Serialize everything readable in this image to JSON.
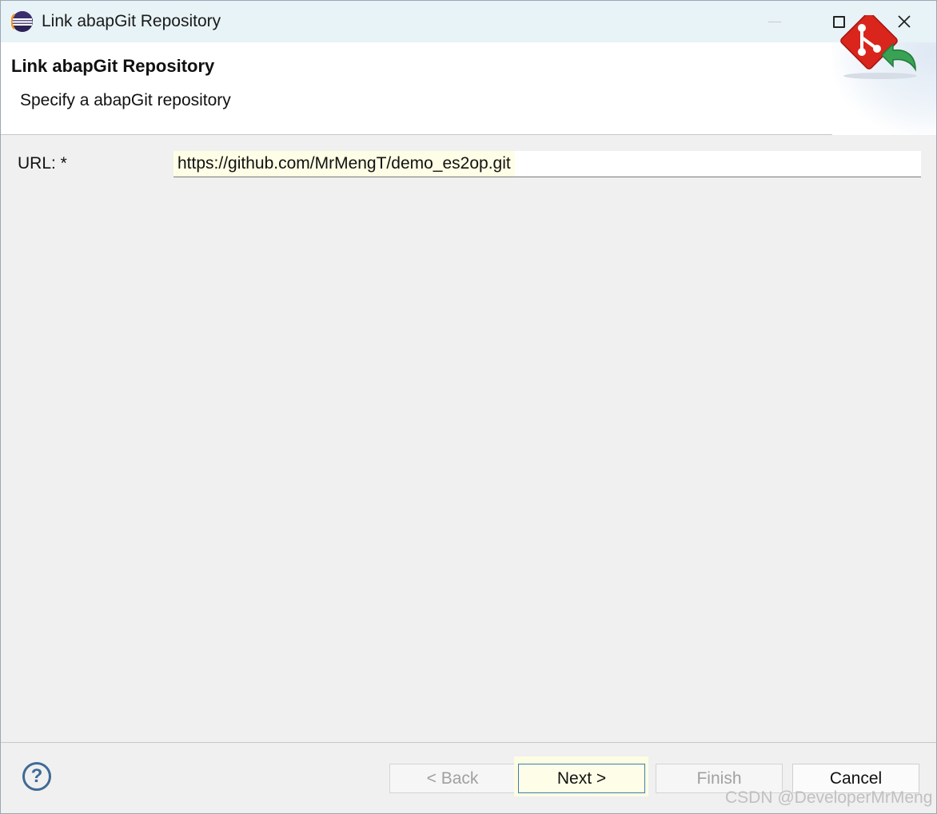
{
  "window": {
    "title": "Link abapGit Repository",
    "app_icon": "eclipse-icon"
  },
  "banner": {
    "title": "Link abapGit Repository",
    "description": "Specify a abapGit repository",
    "logo_icon": "git-link-icon"
  },
  "form": {
    "url_label": "URL: *",
    "url_value": "https://github.com/MrMengT/demo_es2op.git"
  },
  "footer": {
    "help_icon": "help-icon",
    "help_glyph": "?",
    "back_label": "< Back",
    "next_label": "Next >",
    "finish_label": "Finish",
    "cancel_label": "Cancel"
  },
  "watermark": "CSDN @DeveloperMrMeng",
  "colors": {
    "titlebar_bg": "#e8f3f7",
    "dialog_bg": "#f0f0f0",
    "field_highlight": "#fefee6",
    "next_focus_border": "#3e7db1",
    "help_blue": "#3e6b96",
    "git_red": "#d9251c",
    "arrow_green": "#3aa255"
  }
}
